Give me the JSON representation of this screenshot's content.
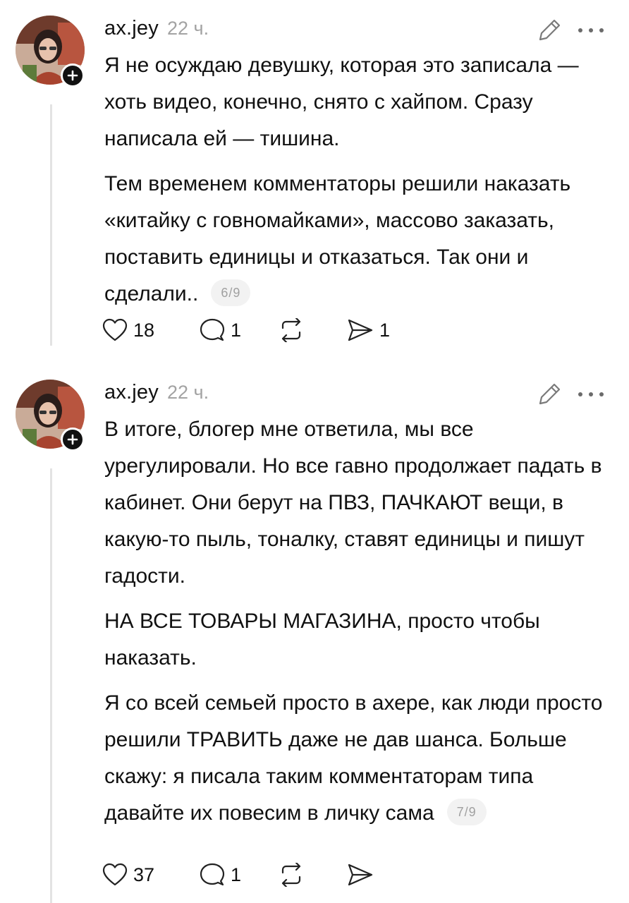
{
  "posts": [
    {
      "username": "ax.jey",
      "timestamp": "22 ч.",
      "paragraphs": [
        "Я не осуждаю девушку, которая это записала — хоть видео, конечно, снято с хайпом. Сразу написала ей — тишина.",
        "Тем временем комментаторы решили наказать «китайку с говномайками», массово заказать, поставить единицы и отказаться. Так они и сделали.."
      ],
      "counter": "6/9",
      "likes": "18",
      "replies": "1",
      "reposts": "",
      "shares": "1"
    },
    {
      "username": "ax.jey",
      "timestamp": "22 ч.",
      "paragraphs": [
        "В итоге, блогер мне ответила, мы все урегулировали. Но все гавно продолжает падать в кабинет. Они берут на ПВЗ, ПАЧКАЮТ вещи, в какую-то пыль, тоналку, ставят единицы и пишут гадости.",
        "НА ВСЕ ТОВАРЫ МАГАЗИНА, просто чтобы наказать.",
        "Я со всей семьей просто в ахере, как люди просто решили ТРАВИТЬ даже не дав шанса. Больше скажу: я писала таким комментаторам типа давайте их повесим в личку сама"
      ],
      "counter": "7/9",
      "likes": "37",
      "replies": "1",
      "reposts": "",
      "shares": ""
    }
  ],
  "icons": {
    "avatar": "avatar-photo",
    "follow": "plus-icon",
    "edit": "pencil-icon",
    "more": "more-dots-icon",
    "like": "heart-icon",
    "reply": "comment-icon",
    "repost": "repost-icon",
    "share": "send-icon"
  },
  "colors": {
    "text": "#111111",
    "muted": "#a3a3a3",
    "thread_line": "#e3e3e3",
    "badge": "#111111"
  }
}
